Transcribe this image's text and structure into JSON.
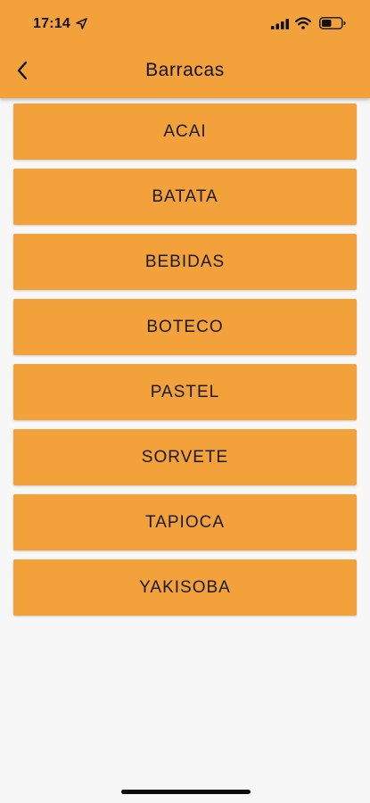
{
  "status_bar": {
    "time": "17:14",
    "icons": [
      "location-arrow-icon",
      "cellular-signal-icon",
      "wifi-icon",
      "battery-icon"
    ]
  },
  "header": {
    "title": "Barracas",
    "back_icon": "chevron-left-icon"
  },
  "items": [
    {
      "label": "ACAI"
    },
    {
      "label": "BATATA"
    },
    {
      "label": "BEBIDAS"
    },
    {
      "label": "BOTECO"
    },
    {
      "label": "PASTEL"
    },
    {
      "label": "SORVETE"
    },
    {
      "label": "TAPIOCA"
    },
    {
      "label": "YAKISOBA"
    }
  ],
  "colors": {
    "accent": "#f3a13a",
    "background": "#f7f7f7",
    "text": "#1a1a1a"
  }
}
